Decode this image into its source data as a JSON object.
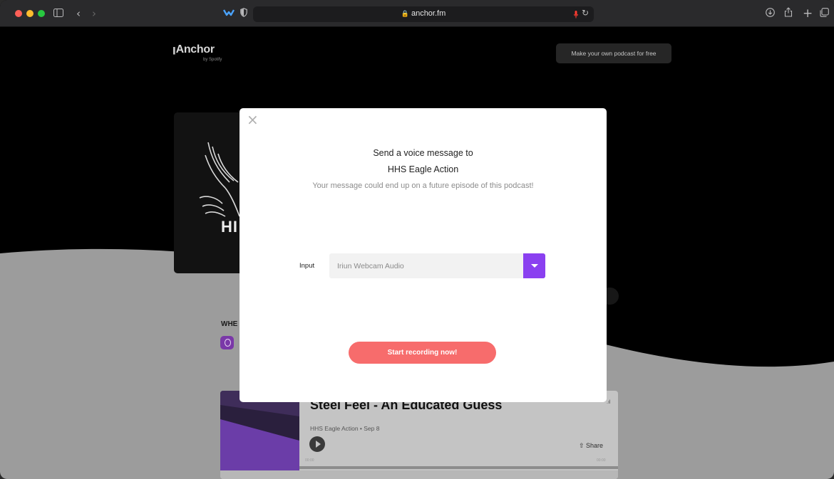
{
  "browser": {
    "url": "anchor.fm",
    "icons": [
      "sidebar-icon",
      "back-icon",
      "forward-icon",
      "extension-icon",
      "shield-icon",
      "lock-icon",
      "mic-icon",
      "reload-icon",
      "download-icon",
      "share-icon",
      "new-tab-icon",
      "tabs-icon"
    ]
  },
  "page": {
    "brand_name": "Anchor",
    "brand_sub": "by Spotify",
    "make_podcast_label": "Make your own podcast for free",
    "cover_letters": "HI",
    "where_label": "WHE",
    "episode": {
      "title": "Steel Feel - An Educated Guess",
      "meta": "HHS Eagle Action • Sep 8",
      "share_label": "Share",
      "time_start": "00:00",
      "time_end": "00:00"
    }
  },
  "modal": {
    "title": "Send a voice message to",
    "podcast_name": "HHS Eagle Action",
    "subtitle": "Your message could end up on a future episode of this podcast!",
    "input_label": "Input",
    "input_value": "Iriun Webcam Audio",
    "record_label": "Start recording now!"
  },
  "colors": {
    "accent_purple": "#8a40f0",
    "record_coral": "#f76c6c"
  }
}
